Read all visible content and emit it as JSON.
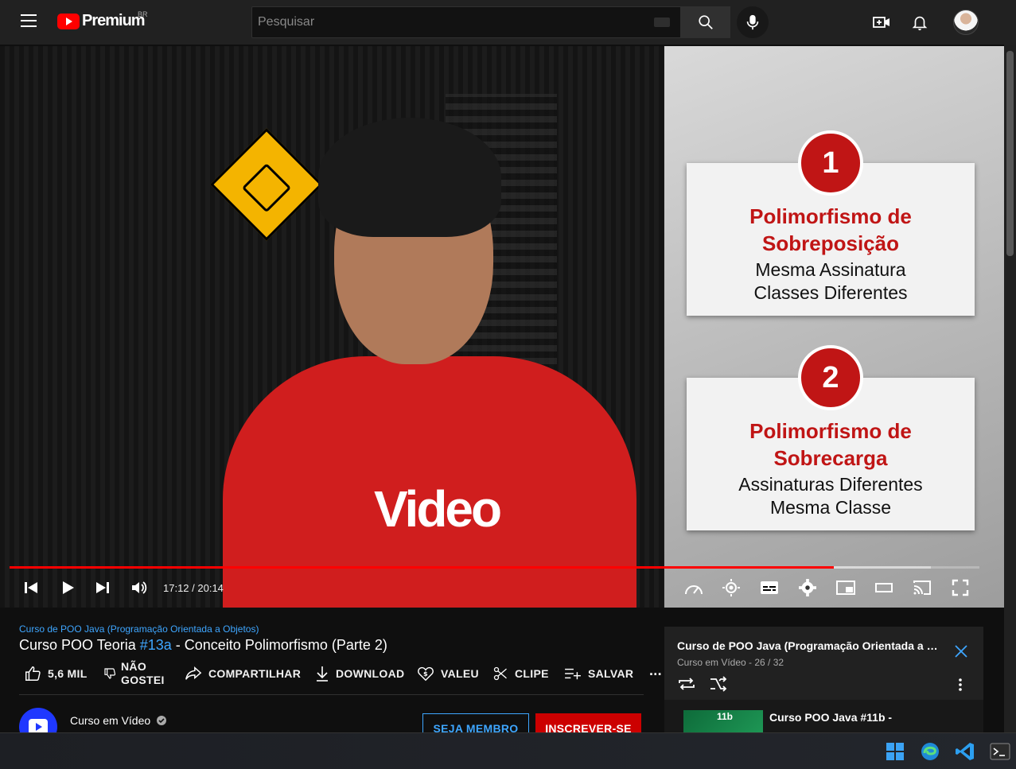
{
  "header": {
    "brand": "Premium",
    "region": "BR",
    "search_placeholder": "Pesquisar"
  },
  "player": {
    "time": "17:12 / 20:14",
    "progress_fraction": 0.85,
    "buffered_fraction": 0.95,
    "shirt_text": "Video",
    "slide": {
      "cards": [
        {
          "number": "1",
          "title_line1": "Polimorfismo de",
          "title_line2": "Sobreposição",
          "desc_line1": "Mesma Assinatura",
          "desc_line2": "Classes Diferentes"
        },
        {
          "number": "2",
          "title_line1": "Polimorfismo de",
          "title_line2": "Sobrecarga",
          "desc_line1": "Assinaturas Diferentes",
          "desc_line2": "Mesma Classe"
        }
      ]
    }
  },
  "video": {
    "playlist_link": "Curso de POO Java (Programação Orientada a Objetos)",
    "title_prefix": "Curso POO Teoria ",
    "title_tag": "#13a",
    "title_suffix": " - Conceito Polimorfismo (Parte 2)"
  },
  "actions": {
    "like": "5,6 MIL",
    "dislike_line1": "NÃO",
    "dislike_line2": "GOSTEI",
    "share": "COMPARTILHAR",
    "download": "DOWNLOAD",
    "thanks": "VALEU",
    "clip": "CLIPE",
    "save": "SALVAR",
    "more": "..."
  },
  "channel": {
    "name": "Curso em Vídeo",
    "join_label": "SEJA MEMBRO",
    "subscribe_label": "INSCREVER-SE"
  },
  "playlist_panel": {
    "title": "Curso de POO Java (Programação Orientada a Obj...",
    "subtitle": "Curso em Vídeo - 26 / 32",
    "item_title": "Curso POO Java #11b -",
    "item_thumb_label": "11b"
  },
  "colors": {
    "accent_red": "#ff0000",
    "link_blue": "#3ea6ff",
    "subscribe_red": "#cc0000",
    "slide_red": "#c01515"
  }
}
